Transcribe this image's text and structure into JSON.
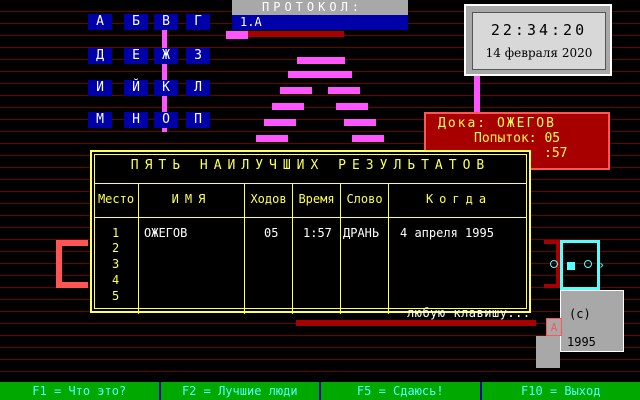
{
  "protocol": {
    "title": "ПРОТОКОЛ:",
    "line1": "1.А"
  },
  "clock": {
    "time": "22:34:20",
    "date": "14 февраля 2020"
  },
  "letters": [
    [
      "А",
      "Б",
      "В",
      "Г"
    ],
    [
      "Д",
      "Е",
      "Ж",
      "З"
    ],
    [
      "И",
      "Й",
      "К",
      "Л"
    ],
    [
      "М",
      "Н",
      "О",
      "П"
    ]
  ],
  "player": {
    "line1": "Дока: ОЖЕГОВ",
    "line2": "Попыток: 05",
    "line3": ":57"
  },
  "results": {
    "title": "ПЯТЬ НАИЛУЧШИХ РЕЗУЛЬТАТОВ",
    "headers": {
      "place": "Место",
      "name": "ИМЯ",
      "moves": "Ходов",
      "time": "Время",
      "word": "Слово",
      "when": "Когда"
    },
    "ranks": [
      "1",
      "2",
      "3",
      "4",
      "5"
    ],
    "rows": [
      {
        "name": "ОЖЕГОВ",
        "moves": "05",
        "time": "1:57",
        "word": "ДРАНЬ",
        "when": "4 апреля 1995"
      }
    ]
  },
  "press_any_key": "любую клавишу...",
  "copyright": {
    "mark": "(с)",
    "year": "1995",
    "letter": "А"
  },
  "statusbar": {
    "f1": "F1 = Что это?",
    "f2": "F2 = Лучшие люди",
    "f5": "F5 = Сдаюсь!",
    "f10": "F10 = Выход"
  },
  "colors": {
    "background": "#000000",
    "scanline": "#6b0000",
    "letter_bg": "#0000a8",
    "dialog_text": "#ffff55",
    "status_bg": "#00a800",
    "status_text": "#55ffff",
    "accent_magenta": "#ff55ff"
  }
}
